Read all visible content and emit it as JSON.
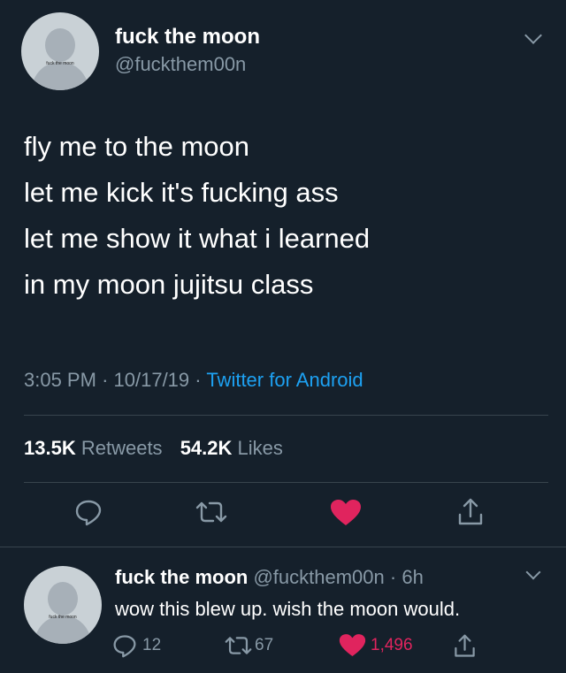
{
  "tweet": {
    "author_name": "fuck the moon",
    "author_handle": "@fuckthem00n",
    "avatar_tag": "fuck the moon",
    "text_lines": [
      "fly me to the moon",
      "let me kick it's fucking ass",
      "let me show it what i learned",
      "in my moon jujitsu class"
    ],
    "time": "3:05 PM",
    "date": "10/17/19",
    "separator": "·",
    "source": "Twitter for Android",
    "retweets_count": "13.5K",
    "retweets_label": "Retweets",
    "likes_count": "54.2K",
    "likes_label": "Likes",
    "actions": {
      "reply_icon": "reply-bubble-icon",
      "retweet_icon": "retweet-arrows-icon",
      "like_icon": "heart-filled-icon",
      "share_icon": "share-upload-icon"
    }
  },
  "reply": {
    "author_name": "fuck the moon",
    "author_handle": "@fuckthem00n",
    "time_ago": "6h",
    "separator": "·",
    "avatar_tag": "fuck the moon",
    "text": "wow this blew up. wish the moon would.",
    "reply_count": "12",
    "retweet_count": "67",
    "like_count": "1,496"
  },
  "colors": {
    "background": "#15202b",
    "secondary_text": "#8899a6",
    "link": "#1da1f2",
    "like": "#e0245e",
    "divider": "#38444d"
  }
}
